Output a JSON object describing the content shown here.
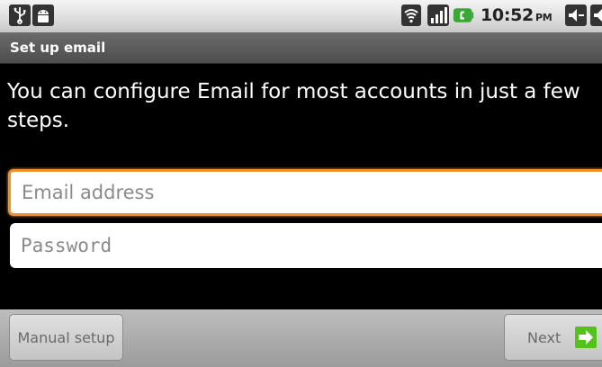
{
  "status_bar": {
    "time": "10:52",
    "time_suffix": "PM",
    "icons": [
      "usb-icon",
      "android-icon",
      "wifi-icon",
      "signal-icon",
      "battery-icon",
      "volume-down-icon",
      "volume-up-icon"
    ]
  },
  "title_bar": {
    "title": "Set up email"
  },
  "main": {
    "instructions": "You can configure Email for most accounts in just a few steps.",
    "email_placeholder": "Email address",
    "password_placeholder": "Password"
  },
  "buttons": {
    "manual_setup": "Manual setup",
    "next": "Next"
  },
  "colors": {
    "focus_border": "#f0912c",
    "next_arrow": "#55c21c"
  }
}
